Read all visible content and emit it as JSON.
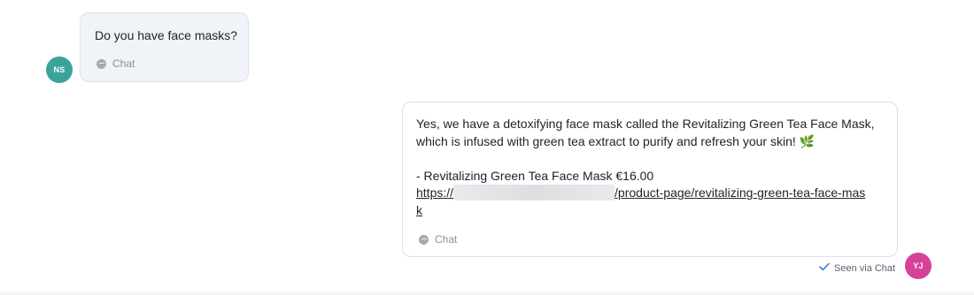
{
  "conversation": {
    "incoming": {
      "avatar_initials": "NS",
      "avatar_color": "#3aa39a",
      "text": "Do you have face masks?",
      "channel": "Chat",
      "channel_icon": "chat-bubble-icon"
    },
    "outgoing": {
      "avatar_initials": "YJ",
      "avatar_color": "#d8419a",
      "line1": "Yes, we have a detoxifying face mask called the Revitalizing Green Tea Face Mask,",
      "line2": "which is infused with green tea extract to purify and refresh your skin! 🌿",
      "product_line": "- Revitalizing Green Tea Face Mask €16.00",
      "link_prefix": "https://",
      "link_suffix": "/product-page/revitalizing-green-tea-face-mas",
      "link_tail": "k",
      "channel": "Chat",
      "channel_icon": "chat-bubble-icon",
      "status_icon": "checkmark-icon",
      "status": "Seen via Chat"
    }
  }
}
